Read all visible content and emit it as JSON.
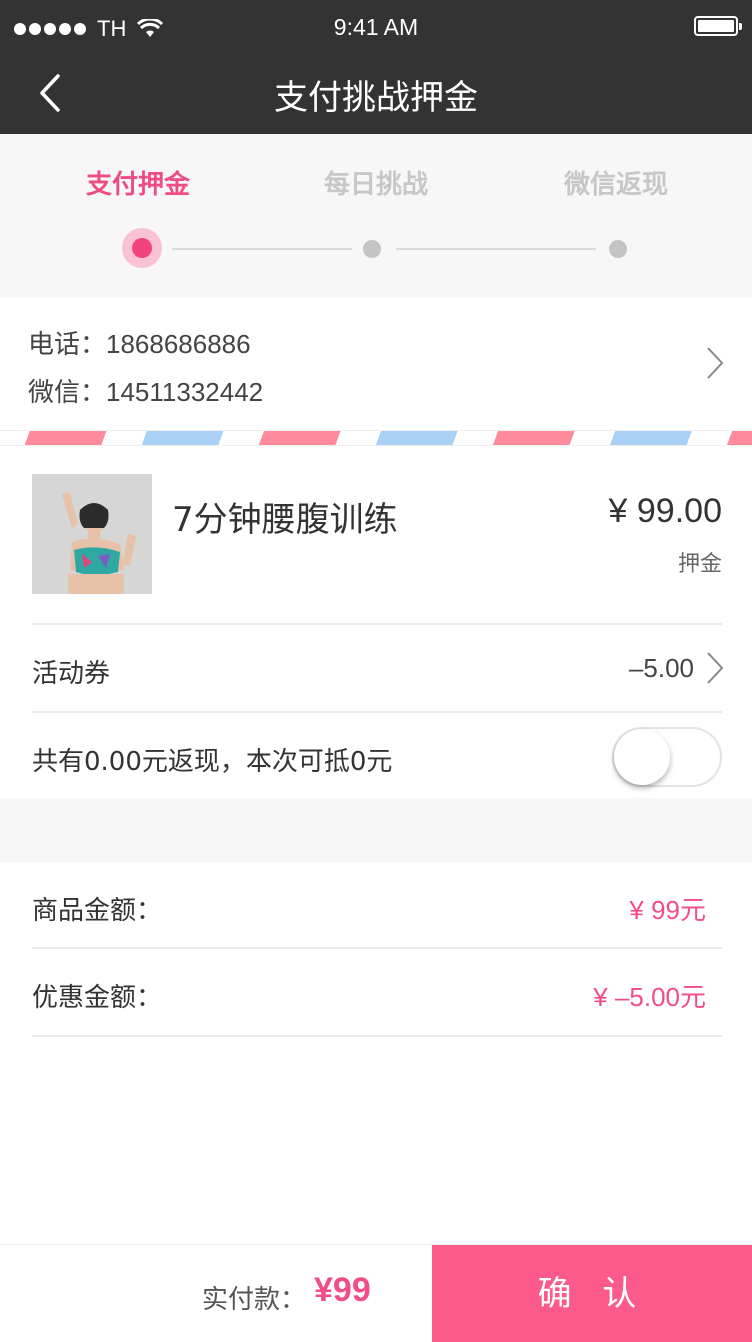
{
  "status_bar": {
    "carrier": "TH",
    "time": "9:41 AM"
  },
  "nav": {
    "title": "支付挑战押金"
  },
  "steps": [
    {
      "label": "支付押金",
      "active": true
    },
    {
      "label": "每日挑战",
      "active": false
    },
    {
      "label": "微信返现",
      "active": false
    }
  ],
  "contact": {
    "phone": "电话：1868686886",
    "wechat": "微信：14511332442"
  },
  "product": {
    "name": "7分钟腰腹训练",
    "price": "¥ 99.00",
    "price_label": "押金"
  },
  "coupon": {
    "label": "活动券",
    "value": "–5.00"
  },
  "cashback": {
    "label": "共有0.00元返现，本次可抵0元",
    "enabled": false
  },
  "summary": {
    "goods_label": "商品金额：",
    "goods_value": "¥ 99元",
    "discount_label": "优惠金额：",
    "discount_value": "¥ –5.00元"
  },
  "footer": {
    "pay_label": "实付款：",
    "pay_amount": "¥99",
    "confirm": "确 认"
  },
  "colors": {
    "accent": "#f24e86",
    "nav_bg": "#333333",
    "confirm_bg": "#fb5a8b"
  }
}
